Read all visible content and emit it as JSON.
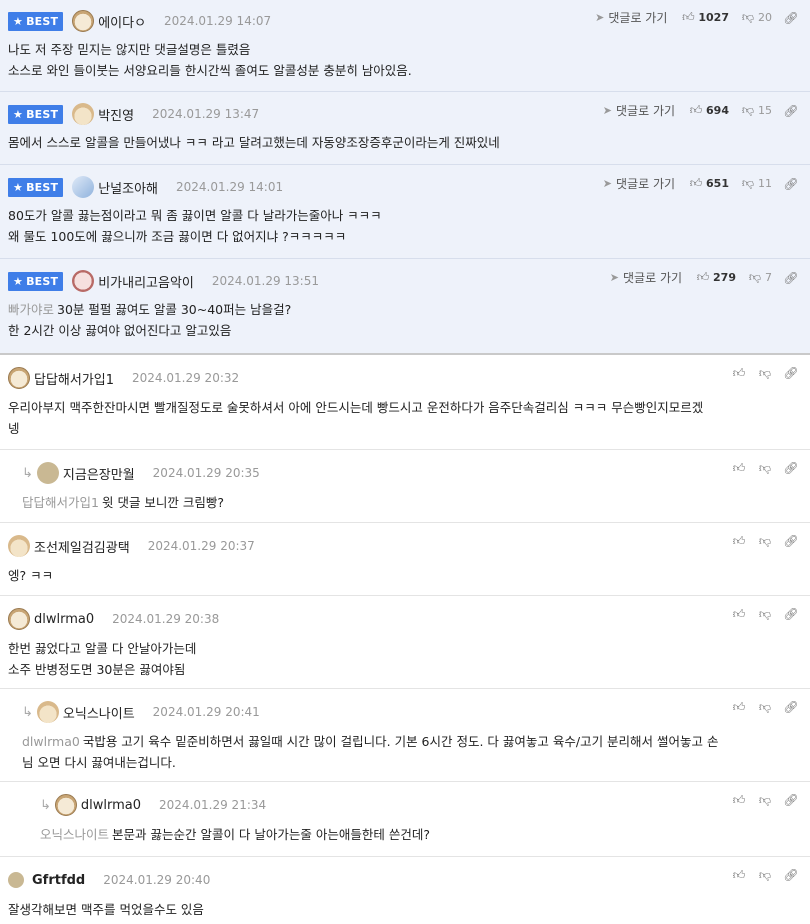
{
  "labels": {
    "best": "BEST",
    "reply_link": "댓글로 가기"
  },
  "colors": {
    "best_badge": "#3f7ee8",
    "best_bg": "#eef2fa"
  },
  "best_comments": [
    {
      "nick": "에이다ㅇ",
      "date": "2024.01.29 14:07",
      "up": "1027",
      "down": "20",
      "lines": [
        "나도 저 주장 믿지는 않지만 댓글설명은 틀렸음",
        "소스로 와인 들이붓는 서양요리들 한시간씩 졸여도 알콜성분 충분히 남아있음."
      ]
    },
    {
      "nick": "박진영",
      "date": "2024.01.29 13:47",
      "up": "694",
      "down": "15",
      "lines": [
        "몸에서 스스로 알콜을 만들어냈나 ㅋㅋ 라고 달려고했는데 자동양조장증후군이라는게 진짜있네"
      ]
    },
    {
      "nick": "난널조아해",
      "date": "2024.01.29 14:01",
      "up": "651",
      "down": "11",
      "lines": [
        "80도가 알콜 끓는점이라고 뭐 좀 끓이면 알콜 다 날라가는줄아나 ㅋㅋㅋ",
        "왜 물도 100도에 끓으니까 조금 끓이면 다 없어지냐 ?ㅋㅋㅋㅋㅋ"
      ]
    },
    {
      "nick": "비가내리고음악이",
      "date": "2024.01.29 13:51",
      "up": "279",
      "down": "7",
      "mention": "빠가야로",
      "lines": [
        "30분 펄펄 끓여도 알콜 30~40퍼는 남을걸?",
        "한 2시간 이상 끓여야 없어진다고 알고있음"
      ]
    }
  ],
  "comments": [
    {
      "nick": "답답해서가입1",
      "date": "2024.01.29 20:32",
      "lines": [
        "우리아부지 맥주한잔마시면 빨개질정도로 술못하셔서 아에 안드시는데 빵드시고 운전하다가 음주단속걸리심 ㅋㅋㅋ 무슨빵인지모르겠",
        "넹"
      ]
    },
    {
      "nick": "지금은장만월",
      "date": "2024.01.29 20:35",
      "mention": "답답해서가입1",
      "lines": [
        "윗 댓글 보니깐 크림빵?"
      ]
    },
    {
      "nick": "조선제일검김광택",
      "date": "2024.01.29 20:37",
      "lines": [
        "엥? ㅋㅋ"
      ]
    },
    {
      "nick": "dlwlrma0",
      "date": "2024.01.29 20:38",
      "lines": [
        "한번 끓었다고 알콜 다 안날아가는데",
        "소주 반병정도면 30분은 끓여야됨"
      ]
    },
    {
      "nick": "오닉스나이트",
      "date": "2024.01.29 20:41",
      "mention": "dlwlrma0",
      "lines": [
        "국밥용 고기 육수 밑준비하면서 끓일때 시간 많이 걸립니다. 기본 6시간 정도. 다 끓여놓고 육수/고기 분리해서 썰어놓고 손",
        "님 오면 다시 끓여내는겁니다."
      ]
    },
    {
      "nick": "dlwlrma0",
      "date": "2024.01.29 21:34",
      "mention": "오닉스나이트",
      "lines": [
        "본문과 끓는순간 알콜이 다 날아가는줄 아는애들한테 쓴건데?"
      ]
    },
    {
      "nick": "Gfrtfdd",
      "date": "2024.01.29 20:40",
      "lines": [
        "잘생각해보면 맥주를 먹었을수도 있음"
      ]
    }
  ]
}
